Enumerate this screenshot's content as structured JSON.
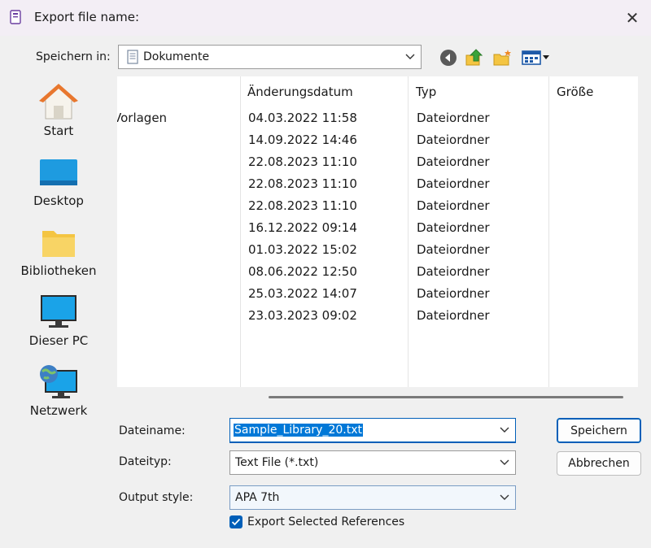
{
  "window": {
    "title": "Export file name:",
    "close_glyph": "✕"
  },
  "toolbar": {
    "look_in_label": "Speichern in:",
    "location": "Dokumente",
    "icons": [
      "back-icon",
      "up-folder-icon",
      "new-folder-icon",
      "view-menu-icon"
    ]
  },
  "places": [
    {
      "label": "Start",
      "icon": "home-icon"
    },
    {
      "label": "Desktop",
      "icon": "desktop-icon"
    },
    {
      "label": "Bibliotheken",
      "icon": "libraries-icon"
    },
    {
      "label": "Dieser PC",
      "icon": "this-pc-icon"
    },
    {
      "label": "Netzwerk",
      "icon": "network-icon"
    }
  ],
  "file_list": {
    "columns": [
      "Änderungsdatum",
      "Typ",
      "Größe"
    ],
    "rows": [
      {
        "name": "Vorlagen",
        "date": "04.03.2022 11:58",
        "type": "Dateiordner"
      },
      {
        "name": "",
        "date": "14.09.2022 14:46",
        "type": "Dateiordner"
      },
      {
        "name": "",
        "date": "22.08.2023 11:10",
        "type": "Dateiordner"
      },
      {
        "name": "",
        "date": "22.08.2023 11:10",
        "type": "Dateiordner"
      },
      {
        "name": "",
        "date": "22.08.2023 11:10",
        "type": "Dateiordner"
      },
      {
        "name": "",
        "date": "16.12.2022 09:14",
        "type": "Dateiordner"
      },
      {
        "name": "",
        "date": "01.03.2022 15:02",
        "type": "Dateiordner"
      },
      {
        "name": "",
        "date": "08.06.2022 12:50",
        "type": "Dateiordner"
      },
      {
        "name": "",
        "date": "25.03.2022 14:07",
        "type": "Dateiordner"
      },
      {
        "name": "",
        "date": "23.03.2023 09:02",
        "type": "Dateiordner"
      }
    ]
  },
  "form": {
    "filename_label": "Dateiname:",
    "filename_value": "Sample_Library_20.txt",
    "filetype_label": "Dateityp:",
    "filetype_value": "Text File (*.txt)",
    "output_style_label": "Output style:",
    "output_style_value": "APA 7th",
    "export_selected_label": "Export Selected References",
    "export_selected_checked": true
  },
  "buttons": {
    "save": "Speichern",
    "cancel": "Abbrechen"
  },
  "colors": {
    "accent": "#005fb8",
    "selection": "#0078d7",
    "folder": "#f4c542"
  }
}
